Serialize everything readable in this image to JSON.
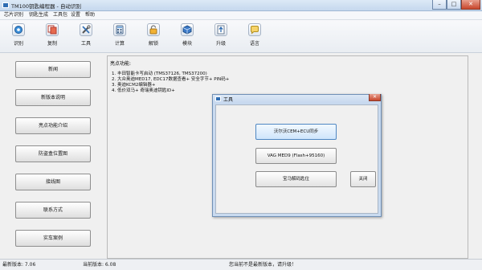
{
  "window": {
    "title": "TM100钥匙编程器 - 自动识别",
    "min_label": "–",
    "max_label": "□",
    "close_label": "✕"
  },
  "menu": [
    "芯片识别",
    "钥匙生成",
    "工具包",
    "设置",
    "帮助"
  ],
  "toolbar": [
    {
      "label": "识别",
      "icon": "identify-icon"
    },
    {
      "label": "复制",
      "icon": "copy-icon"
    },
    {
      "label": "工具",
      "icon": "tools-icon"
    },
    {
      "label": "计算",
      "icon": "calculator-icon"
    },
    {
      "label": "解锁",
      "icon": "unlock-icon"
    },
    {
      "label": "模块",
      "icon": "module-icon"
    },
    {
      "label": "升级",
      "icon": "upgrade-icon"
    },
    {
      "label": "语言",
      "icon": "language-icon"
    }
  ],
  "left_buttons": [
    "新闻",
    "新版本说明",
    "亮点功能介绍",
    "防盗盒位置图",
    "接线图",
    "联系方式",
    "实车案例"
  ],
  "highlights": {
    "title": "亮点功能:",
    "lines": [
      "1. 丰田智能卡写启动 (TMS37126, TMS37200)",
      "2. 大众奥迪MED17, EDC17数据查看+ 安全字节+ PIN码+",
      "3. 奥迪KCM2编辑器+",
      "4. 低价双马+ 奇瑞奥迪钥匙ID+"
    ]
  },
  "dialog": {
    "title": "工具",
    "close_label": "✕",
    "buttons": {
      "volvo": "沃尔沃CEM+ECU同步",
      "vag": "VAG MED9 (Flash+95160)",
      "bmw": "宝马解码匙位",
      "close": "关闭"
    }
  },
  "status": {
    "latest_version": "最新版本: 7.06",
    "current_version": "当前版本: 6.08",
    "message": "您当前不是最新版本，请升级！"
  },
  "colors": {
    "accent": "#2f6db2",
    "dialog_frame": "#c9daef"
  }
}
